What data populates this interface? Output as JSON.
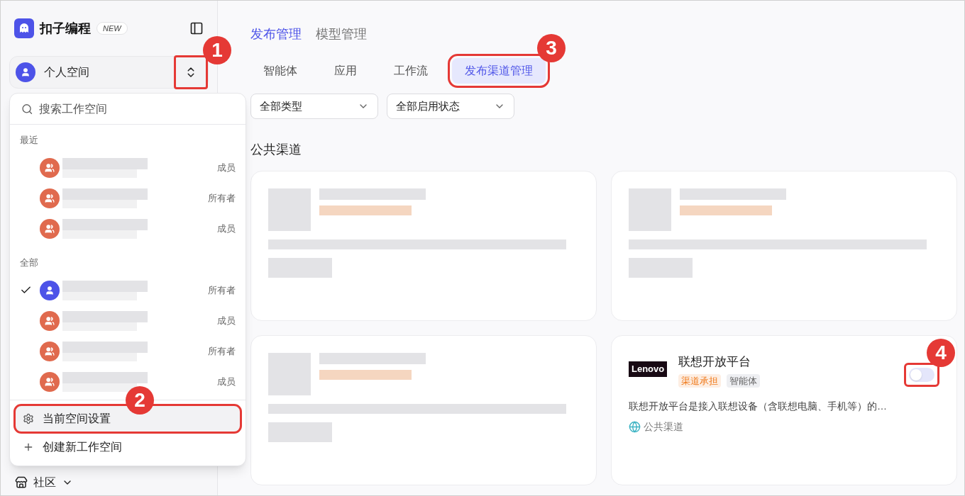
{
  "sidebar": {
    "logo_text": "扣子编程",
    "badge": "NEW",
    "workspace": "个人空间",
    "annotation": "1"
  },
  "workspace_menu": {
    "search_placeholder": "搜索工作空间",
    "sections": [
      {
        "title": "最近",
        "items": [
          {
            "kind": "team",
            "role": "成员",
            "selected": false
          },
          {
            "kind": "team",
            "role": "所有者",
            "selected": false
          },
          {
            "kind": "team",
            "role": "成员",
            "selected": false
          }
        ]
      },
      {
        "title": "全部",
        "items": [
          {
            "kind": "personal",
            "role": "所有者",
            "selected": true
          },
          {
            "kind": "team",
            "role": "成员",
            "selected": false
          },
          {
            "kind": "team",
            "role": "所有者",
            "selected": false
          },
          {
            "kind": "team",
            "role": "成员",
            "selected": false
          }
        ]
      }
    ],
    "actions": [
      {
        "kind": "settings",
        "label": "当前空间设置",
        "highlighted": true,
        "annotation": "2"
      },
      {
        "kind": "create",
        "label": "创建新工作空间",
        "highlighted": false
      }
    ]
  },
  "nav": {
    "label": "社区"
  },
  "main": {
    "top_tabs": [
      {
        "label": "发布管理",
        "selected": true
      },
      {
        "label": "模型管理",
        "selected": false
      }
    ],
    "sub_tabs": [
      {
        "label": "智能体",
        "selected": false
      },
      {
        "label": "应用",
        "selected": false
      },
      {
        "label": "工作流",
        "selected": false
      },
      {
        "label": "发布渠道管理",
        "selected": true,
        "annotation": "3"
      }
    ],
    "filters": [
      {
        "value": "全部类型"
      },
      {
        "value": "全部启用状态"
      }
    ],
    "section_title": "公共渠道",
    "cards": [
      {
        "kind": "blurred"
      },
      {
        "kind": "blurred"
      },
      {
        "kind": "blurred"
      },
      {
        "kind": "channel",
        "name": "联想开放平台",
        "logo": "Lenovo",
        "tags": [
          {
            "kind": "cost",
            "label": "渠道承担"
          },
          {
            "kind": "type",
            "label": "智能体"
          }
        ],
        "description": "联想开放平台是接入联想设备（含联想电脑、手机等）的…",
        "scope": "公共渠道",
        "on": false,
        "annotation": "4"
      }
    ]
  }
}
